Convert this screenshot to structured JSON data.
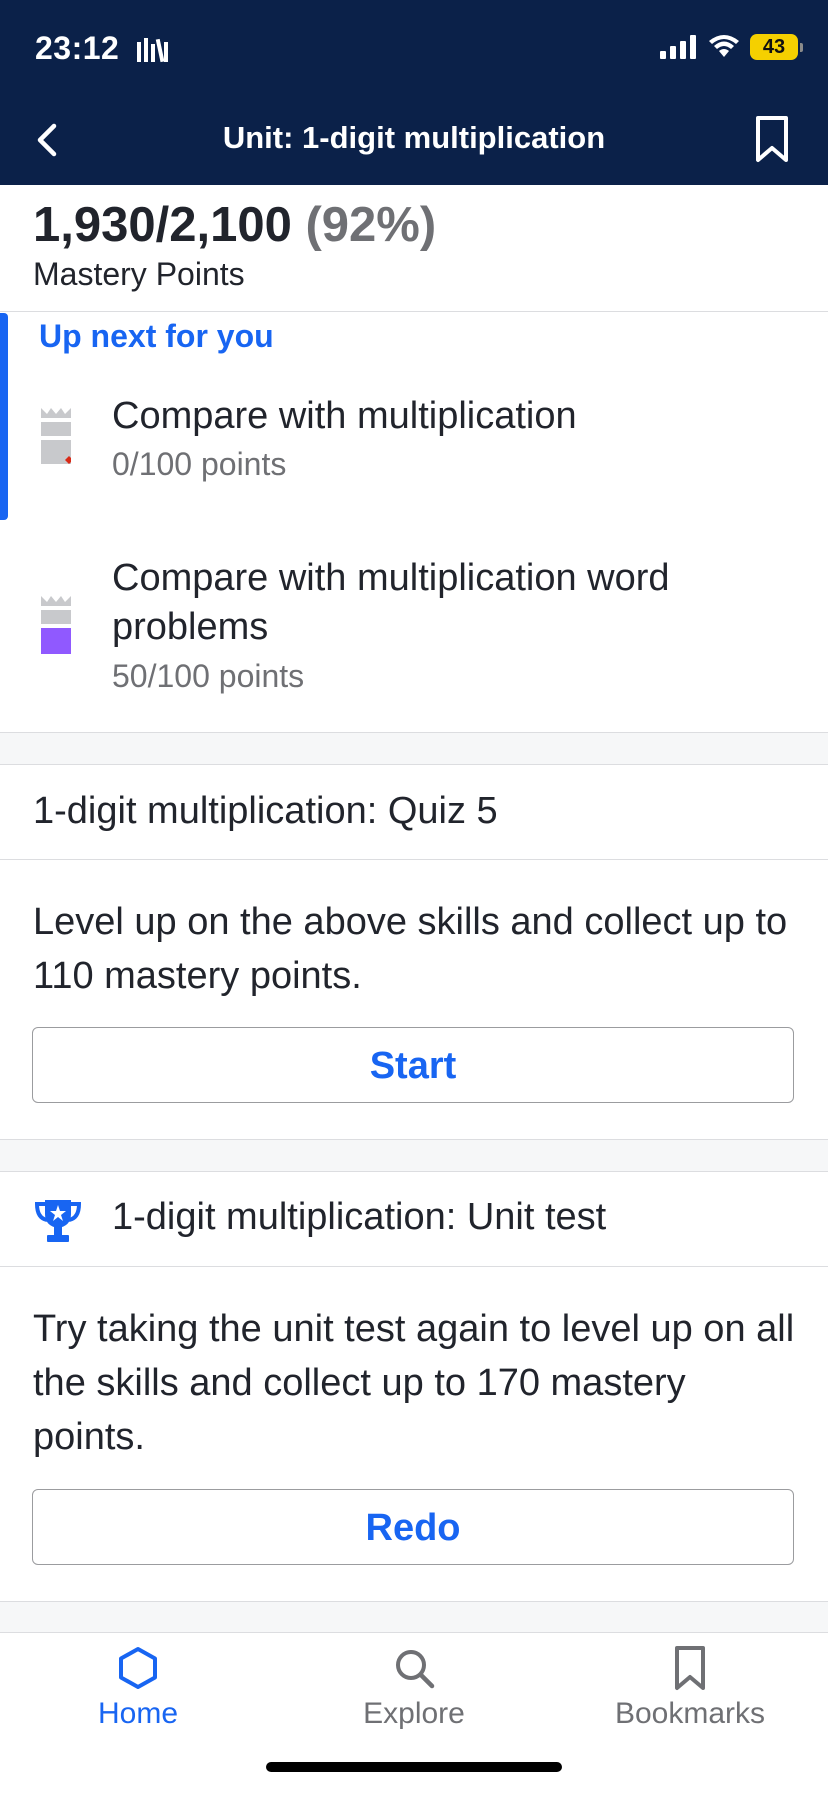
{
  "status_bar": {
    "time": "23:12",
    "battery": "43"
  },
  "nav": {
    "title": "Unit: 1-digit multiplication"
  },
  "mastery": {
    "points": "1,930/2,100",
    "percent": "(92%)",
    "label": "Mastery Points"
  },
  "up_next": {
    "label": "Up next for you"
  },
  "skills": [
    {
      "title": "Compare with multiplication",
      "points": "0/100 points",
      "level_color": "#c8c9cc"
    },
    {
      "title": "Compare with multiplication word problems",
      "points": "50/100 points",
      "level_color": "#9059ff"
    }
  ],
  "quiz": {
    "title": "1-digit multiplication: Quiz 5",
    "description": "Level up on the above skills and collect up to 110 mastery points.",
    "button": "Start"
  },
  "unit_test": {
    "title": "1-digit multiplication: Unit test",
    "description": "Try taking the unit test again to level up on all the skills and collect up to 170 mastery points.",
    "button": "Redo"
  },
  "tabs": [
    {
      "label": "Home",
      "icon": "hexagon-home-icon",
      "active": true
    },
    {
      "label": "Explore",
      "icon": "search-icon",
      "active": false
    },
    {
      "label": "Bookmarks",
      "icon": "bookmark-icon",
      "active": false
    }
  ],
  "colors": {
    "header": "#0b2149",
    "accent": "#1865f2",
    "muted": "#6f7074",
    "mastered_purple": "#9059ff"
  }
}
